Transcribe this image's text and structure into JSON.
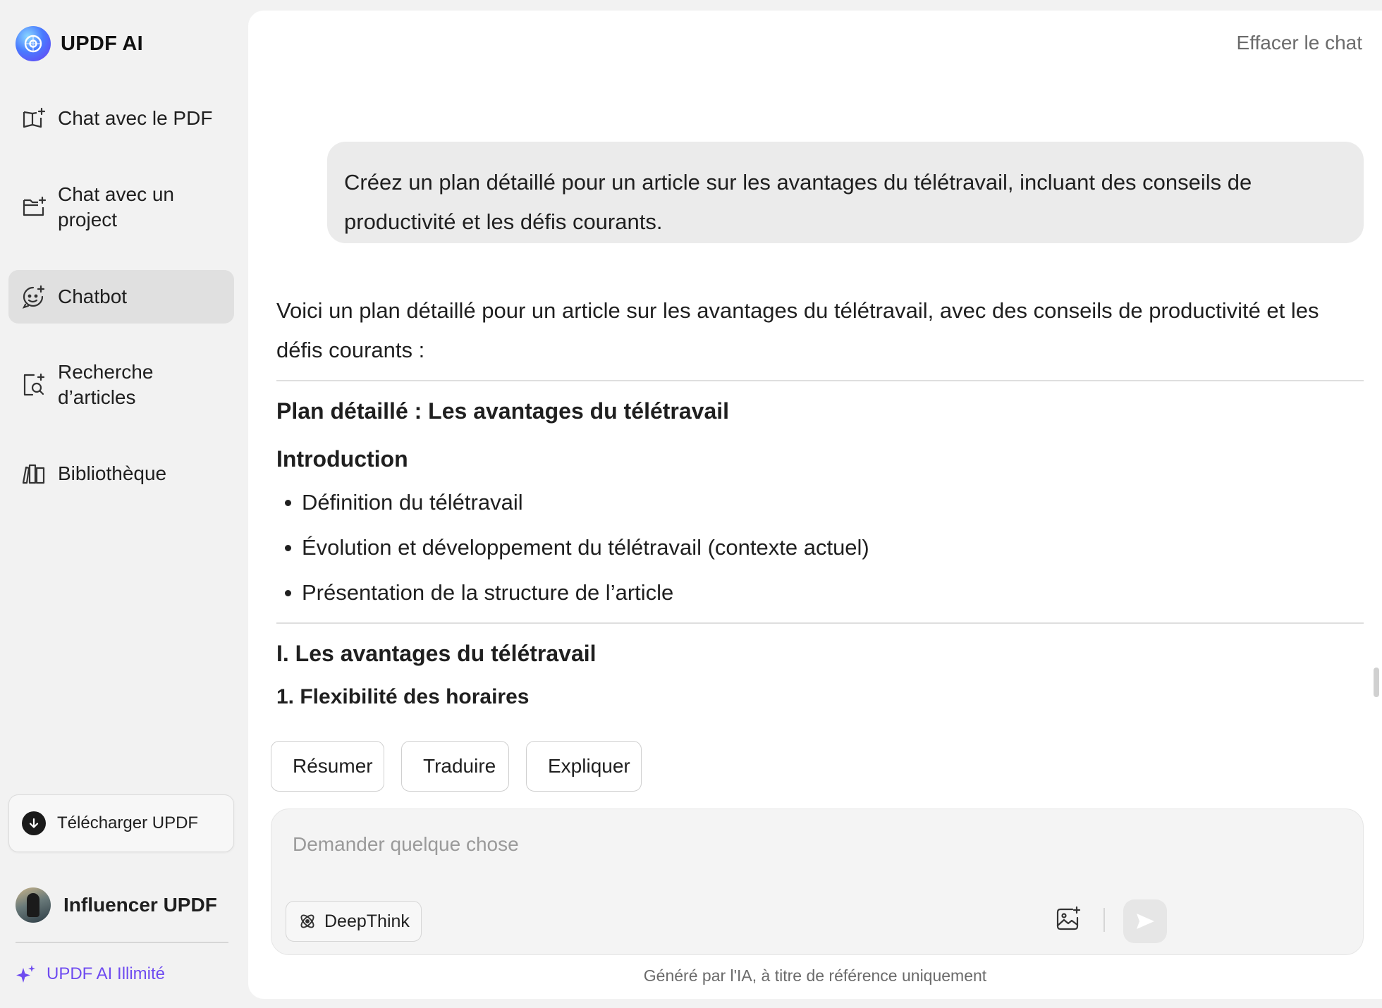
{
  "app": {
    "name": "UPDF AI"
  },
  "sidebar": {
    "items": [
      {
        "label": "Chat avec le PDF",
        "icon": "book-sparkle-icon"
      },
      {
        "label": "Chat avec un project",
        "icon": "folder-sparkle-icon"
      },
      {
        "label": "Chatbot",
        "icon": "chatbot-face-icon",
        "active": true
      },
      {
        "label": "Recherche d’articles",
        "icon": "document-search-icon"
      },
      {
        "label": "Bibliothèque",
        "icon": "library-books-icon"
      }
    ],
    "download_label": "Télécharger UPDF",
    "user_name": "Influencer UPDF",
    "unlimited_label": "UPDF AI Illimité"
  },
  "header": {
    "clear_chat": "Effacer le chat"
  },
  "conversation": {
    "user_message": "Créez un plan détaillé pour un article sur les avantages du télétravail, incluant des conseils de productivité et les défis courants.",
    "answer": {
      "intro": "Voici un plan détaillé pour un article sur les avantages du télétravail, avec des conseils de productivité et les défis courants :",
      "title": "Plan détaillé : Les avantages du télétravail",
      "section_intro": "Introduction",
      "bullets": [
        "Définition du télétravail",
        "Évolution et développement du télétravail (contexte actuel)",
        "Présentation de la structure de l’article"
      ],
      "section_one": "I. Les avantages du télétravail",
      "subsection_one": "1. Flexibilité des horaires"
    }
  },
  "quick_actions": [
    {
      "label": "Résumer",
      "icon": "summarize-icon"
    },
    {
      "label": "Traduire",
      "icon": "translate-icon"
    },
    {
      "label": "Expliquer",
      "icon": "explain-book-icon"
    }
  ],
  "composer": {
    "placeholder": "Demander quelque chose",
    "deepthink_label": "DeepThink"
  },
  "footer": {
    "disclaimer": "Généré par l'IA, à titre de référence uniquement"
  },
  "colors": {
    "accent": "#6f4cf0",
    "active_nav": "#e0e0e0",
    "bubble": "#ebebeb"
  }
}
